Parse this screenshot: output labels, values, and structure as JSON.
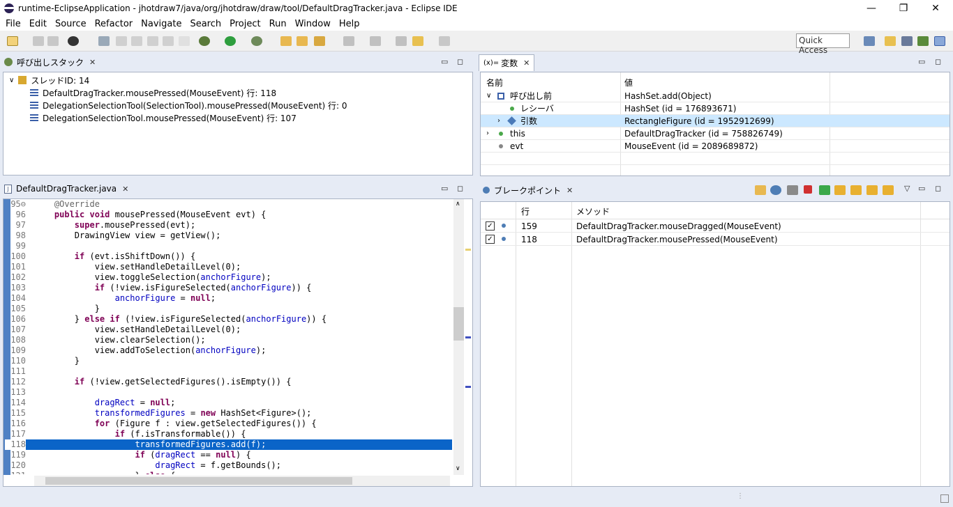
{
  "window": {
    "title": "runtime-EclipseApplication - jhotdraw7/java/org/jhotdraw/draw/tool/DefaultDragTracker.java - Eclipse IDE",
    "min": "—",
    "restore": "❐",
    "close": "✕"
  },
  "menu": [
    "File",
    "Edit",
    "Source",
    "Refactor",
    "Navigate",
    "Search",
    "Project",
    "Run",
    "Window",
    "Help"
  ],
  "quick_access": "Quick Access",
  "callstack": {
    "tab_label": "呼び出しスタック",
    "thread": "スレッドID: 14",
    "frames": [
      "DefaultDragTracker.mousePressed(MouseEvent) 行: 118",
      "DelegationSelectionTool(SelectionTool).mousePressed(MouseEvent) 行: 0",
      "DelegationSelectionTool.mousePressed(MouseEvent) 行: 107"
    ]
  },
  "variables": {
    "tab_prefix": "(x)=",
    "tab_label": "変数",
    "col_name": "名前",
    "col_value": "値",
    "rows": [
      {
        "name": "呼び出し前",
        "value": "HashSet.add(Object)"
      },
      {
        "name": "レシーバ",
        "value": "HashSet (id = 176893671)"
      },
      {
        "name": "引数",
        "value": "RectangleFigure (id = 1952912699)"
      },
      {
        "name": "this",
        "value": "DefaultDragTracker (id = 758826749)"
      },
      {
        "name": "evt",
        "value": "MouseEvent (id = 2089689872)"
      }
    ]
  },
  "editor": {
    "tab_label": "DefaultDragTracker.java",
    "current_line": "118"
  },
  "breakpoints": {
    "tab_label": "ブレークポイント",
    "col_line": "行",
    "col_method": "メソッド",
    "rows": [
      {
        "line": "159",
        "method": "DefaultDragTracker.mouseDragged(MouseEvent)"
      },
      {
        "line": "118",
        "method": "DefaultDragTracker.mousePressed(MouseEvent)"
      }
    ]
  },
  "colors": {
    "accent": "#0a64c8",
    "selection": "#cce8ff",
    "keyword": "#7f0055",
    "field": "#0000c0"
  }
}
